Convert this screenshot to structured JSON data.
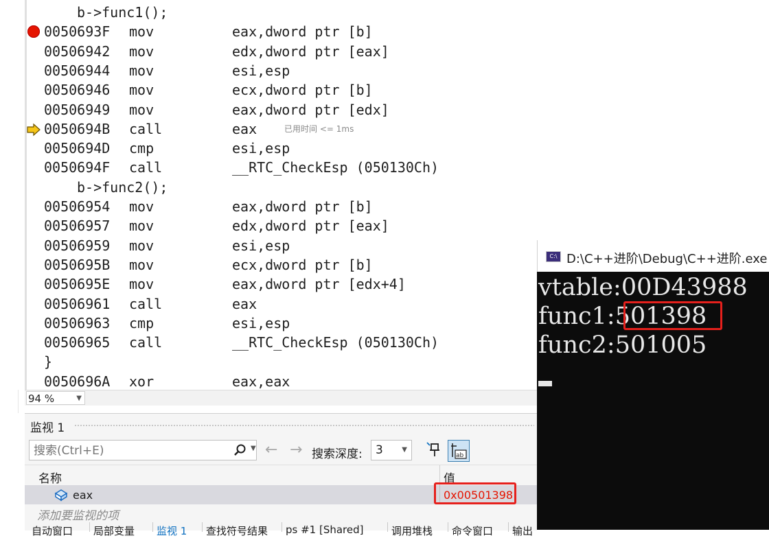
{
  "disassembly": {
    "lines": [
      {
        "kind": "src",
        "text": "b->func1();"
      },
      {
        "kind": "asm",
        "addr": "0050693F",
        "op": "mov",
        "arg": "eax,dword ptr [b]",
        "marker": "breakpoint"
      },
      {
        "kind": "asm",
        "addr": "00506942",
        "op": "mov",
        "arg": "edx,dword ptr [eax]"
      },
      {
        "kind": "asm",
        "addr": "00506944",
        "op": "mov",
        "arg": "esi,esp"
      },
      {
        "kind": "asm",
        "addr": "00506946",
        "op": "mov",
        "arg": "ecx,dword ptr [b]"
      },
      {
        "kind": "asm",
        "addr": "00506949",
        "op": "mov",
        "arg": "eax,dword ptr [edx]"
      },
      {
        "kind": "asm",
        "addr": "0050694B",
        "op": "call",
        "arg": "eax",
        "marker": "current",
        "note": "已用时间 <= 1ms"
      },
      {
        "kind": "asm",
        "addr": "0050694D",
        "op": "cmp",
        "arg": "esi,esp"
      },
      {
        "kind": "asm",
        "addr": "0050694F",
        "op": "call",
        "arg": "__RTC_CheckEsp (050130Ch)"
      },
      {
        "kind": "src",
        "text": "b->func2();"
      },
      {
        "kind": "asm",
        "addr": "00506954",
        "op": "mov",
        "arg": "eax,dword ptr [b]"
      },
      {
        "kind": "asm",
        "addr": "00506957",
        "op": "mov",
        "arg": "edx,dword ptr [eax]"
      },
      {
        "kind": "asm",
        "addr": "00506959",
        "op": "mov",
        "arg": "esi,esp"
      },
      {
        "kind": "asm",
        "addr": "0050695B",
        "op": "mov",
        "arg": "ecx,dword ptr [b]"
      },
      {
        "kind": "asm",
        "addr": "0050695E",
        "op": "mov",
        "arg": "eax,dword ptr [edx+4]"
      },
      {
        "kind": "asm",
        "addr": "00506961",
        "op": "call",
        "arg": "eax"
      },
      {
        "kind": "asm",
        "addr": "00506963",
        "op": "cmp",
        "arg": "esi,esp"
      },
      {
        "kind": "asm",
        "addr": "00506965",
        "op": "call",
        "arg": "__RTC_CheckEsp (050130Ch)"
      },
      {
        "kind": "brace",
        "text": "}"
      },
      {
        "kind": "asm",
        "addr": "0050696A",
        "op": "xor",
        "arg": "eax,eax"
      }
    ],
    "zoom": "94 %"
  },
  "watch": {
    "title": "监视 1",
    "search_placeholder": "搜索(Ctrl+E)",
    "depth_label": "搜索深度:",
    "depth_value": "3",
    "col_name": "名称",
    "col_value": "值",
    "rows": [
      {
        "name": "eax",
        "value": "0x00501398"
      }
    ],
    "add_placeholder": "添加要监视的项",
    "bottom_tabs": [
      "自动窗口",
      "局部变量",
      "监视 1",
      "查找符号结果",
      "ps #1 [Shared]",
      "调用堆栈",
      "命令窗口",
      "输出"
    ]
  },
  "console": {
    "title": "D:\\C++进阶\\Debug\\C++进阶.exe",
    "icon_text": "C:\\",
    "lines": [
      {
        "label": "vtable:",
        "value": "00D43988"
      },
      {
        "label": "func1:",
        "value": "501398"
      },
      {
        "label": "func2:",
        "value": "501005"
      }
    ]
  },
  "colors": {
    "breakpoint": "#e51400",
    "highlight_box": "#e6201c",
    "watch_value": "#e51400",
    "current_arrow": "#f5c518"
  }
}
